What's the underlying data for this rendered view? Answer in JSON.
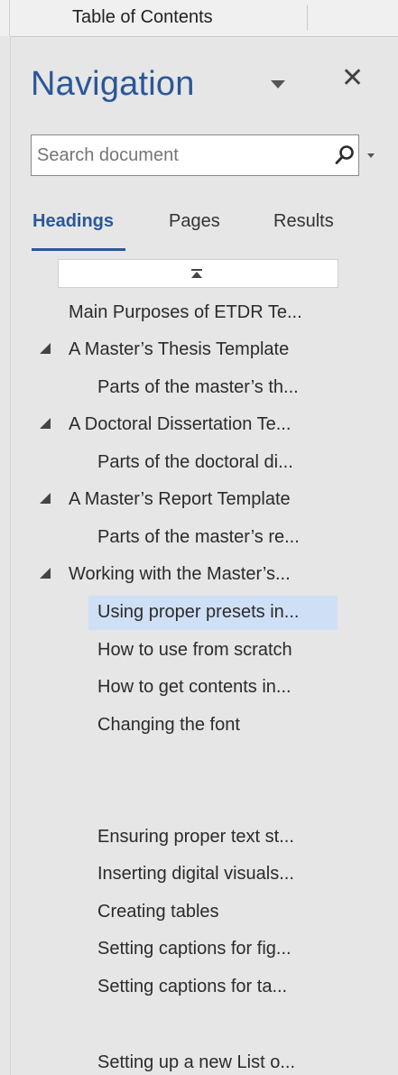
{
  "toolbar": {
    "title": "Table of Contents"
  },
  "pane": {
    "title": "Navigation",
    "close_icon": "close-icon",
    "options_icon": "pane-options-icon"
  },
  "search": {
    "placeholder": "Search document",
    "value": "",
    "icon": "search-icon",
    "dropdown_icon": "chevron-down-icon"
  },
  "tabs": [
    {
      "label": "Headings",
      "active": true
    },
    {
      "label": "Pages",
      "active": false
    },
    {
      "label": "Results",
      "active": false
    }
  ],
  "headings": [
    {
      "text": "Main Purposes of ETDR Te...",
      "level": 1,
      "expandable": false
    },
    {
      "text": "A Master’s Thesis Template",
      "level": 1,
      "expandable": true
    },
    {
      "text": "Parts of the master’s th...",
      "level": 2,
      "expandable": false
    },
    {
      "text": "A Doctoral Dissertation Te...",
      "level": 1,
      "expandable": true
    },
    {
      "text": "Parts of the doctoral di...",
      "level": 2,
      "expandable": false
    },
    {
      "text": "A Master’s Report Template",
      "level": 1,
      "expandable": true
    },
    {
      "text": "Parts of the master’s re...",
      "level": 2,
      "expandable": false
    },
    {
      "text": "Working with the Master’s...",
      "level": 1,
      "expandable": true
    },
    {
      "text": "Using proper presets in...",
      "level": 2,
      "expandable": false,
      "selected": true
    },
    {
      "text": "How to use from scratch",
      "level": 2,
      "expandable": false
    },
    {
      "text": "How to get contents in...",
      "level": 2,
      "expandable": false
    },
    {
      "text": "Changing the font",
      "level": 2,
      "expandable": false
    },
    {
      "text": "Ensuring proper text st...",
      "level": 2,
      "expandable": false
    },
    {
      "text": "Inserting digital visuals...",
      "level": 2,
      "expandable": false
    },
    {
      "text": "Creating tables",
      "level": 2,
      "expandable": false
    },
    {
      "text": "Setting captions for fig...",
      "level": 2,
      "expandable": false
    },
    {
      "text": "Setting captions for ta...",
      "level": 2,
      "expandable": false
    },
    {
      "text": "Setting up a new List o...",
      "level": 2,
      "expandable": false
    }
  ],
  "colors": {
    "accent": "#2b579a",
    "selected": "#cfe0f6",
    "pane_background": "#e6e6e6"
  }
}
